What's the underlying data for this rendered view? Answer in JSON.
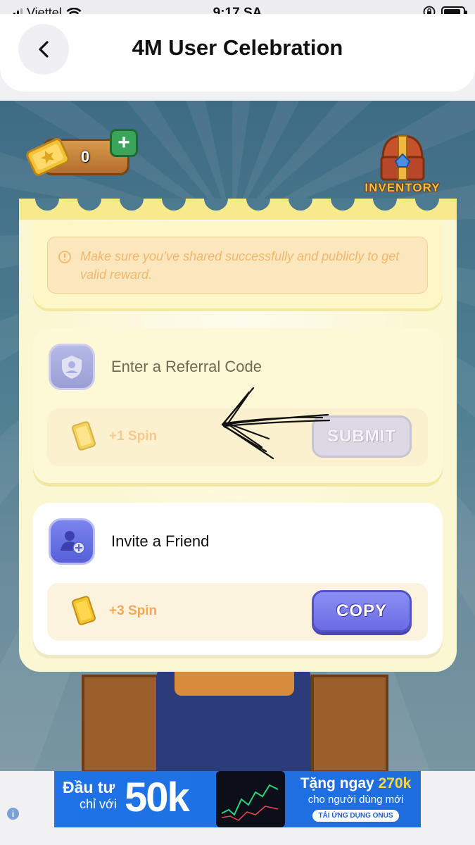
{
  "status_bar": {
    "carrier": "Viettel",
    "time": "9:17 SA"
  },
  "header": {
    "title": "4M User Celebration"
  },
  "game": {
    "ticket_count": "0",
    "inventory_label": "INVENTORY"
  },
  "notice": {
    "text": "Make sure you’ve shared successfully and publicly to get valid reward."
  },
  "referral": {
    "title": "Enter a Referral Code",
    "reward": "+1 Spin",
    "button": "SUBMIT"
  },
  "invite": {
    "title": "Invite a Friend",
    "reward": "+3 Spin",
    "button": "COPY"
  },
  "ad": {
    "line1": "Đầu tư",
    "line2": "chỉ với",
    "big": "50k",
    "promo_prefix": "Tặng ngay",
    "promo_amount": "270k",
    "promo_sub": "cho người dùng mới",
    "cta": "TẢI ỨNG DỤNG ONUS"
  },
  "colors": {
    "accent": "#6b6be4",
    "panel": "#fbf7d2",
    "game_bg": "#4f7f92"
  }
}
